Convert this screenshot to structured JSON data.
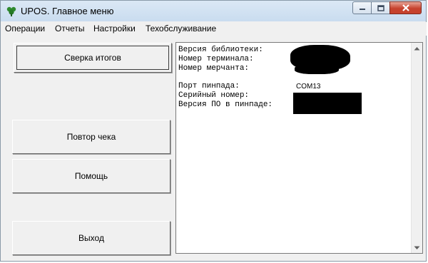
{
  "window": {
    "title": "UPOS. Главное меню",
    "icon": "upos-app-icon"
  },
  "menu": [
    {
      "label": "Операции"
    },
    {
      "label": "Отчеты"
    },
    {
      "label": "Настройки"
    },
    {
      "label": "Техобслуживание"
    }
  ],
  "buttons": {
    "reconcile": "Сверка итогов",
    "repeat_receipt": "Повтор чека",
    "help": "Помощь",
    "exit": "Выход"
  },
  "info": {
    "library_version_label": "Версия библиотеки:",
    "terminal_number_label": "Номер терминала:",
    "merchant_number_label": "Номер мерчанта:",
    "pinpad_port_label": "Порт пинпада:",
    "pinpad_port_value": "COM13",
    "serial_number_label": "Серийный номер:",
    "pinpad_software_label": "Версия ПО в пинпаде:"
  }
}
